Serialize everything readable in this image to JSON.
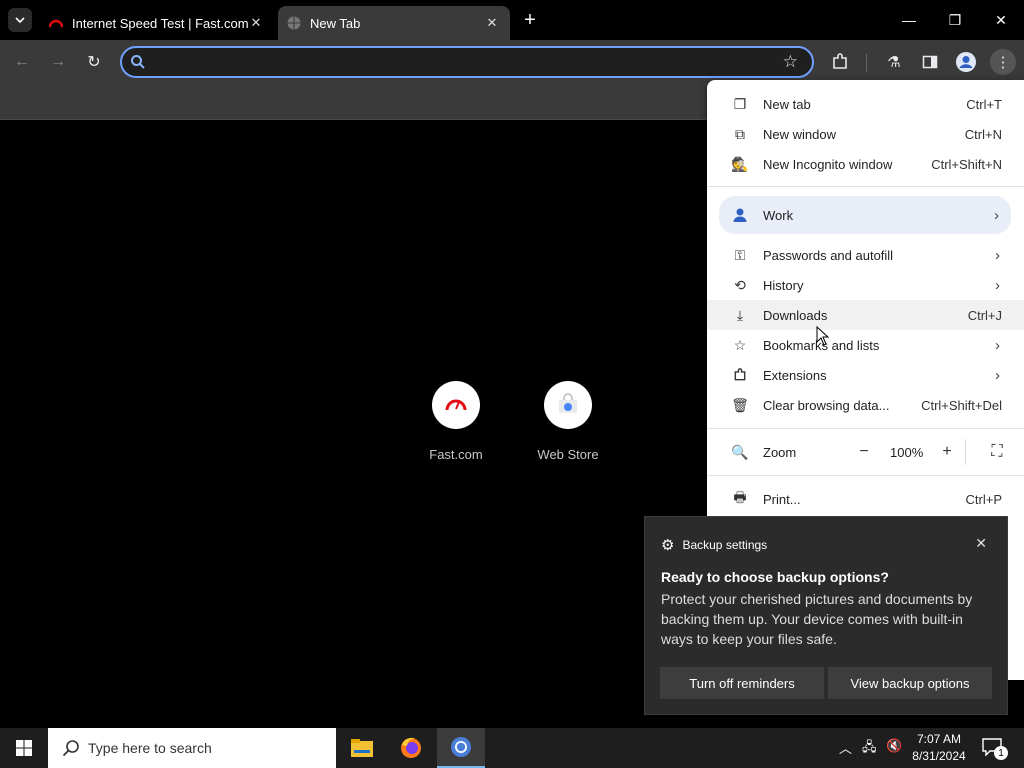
{
  "browser": {
    "tabs": [
      {
        "title": "Internet Speed Test | Fast.com",
        "favicon": "fast-icon"
      },
      {
        "title": "New Tab",
        "favicon": "globe-icon"
      }
    ],
    "new_tab_symbol": "+",
    "omnibox": {
      "value": "",
      "placeholder": ""
    }
  },
  "ntp": {
    "shortcuts": [
      {
        "label": "Fast.com"
      },
      {
        "label": "Web Store"
      }
    ]
  },
  "menu": {
    "items": [
      {
        "label": "New tab",
        "shortcut": "Ctrl+T"
      },
      {
        "label": "New window",
        "shortcut": "Ctrl+N"
      },
      {
        "label": "New Incognito window",
        "shortcut": "Ctrl+Shift+N"
      },
      {
        "label": "Work"
      },
      {
        "label": "Passwords and autofill"
      },
      {
        "label": "History"
      },
      {
        "label": "Downloads",
        "shortcut": "Ctrl+J"
      },
      {
        "label": "Bookmarks and lists"
      },
      {
        "label": "Extensions"
      },
      {
        "label": "Clear browsing data...",
        "shortcut": "Ctrl+Shift+Del"
      },
      {
        "label": "Zoom"
      },
      {
        "label": "Print...",
        "shortcut": "Ctrl+P"
      }
    ],
    "zoom_level": "100%",
    "zoom_minus": "−",
    "zoom_plus": "+"
  },
  "notification": {
    "app": "Backup settings",
    "title": "Ready to choose backup options?",
    "body": "Protect your cherished pictures and documents by backing them up. Your device comes with built-in ways to keep your files safe.",
    "buttons": [
      "Turn off reminders",
      "View backup options"
    ]
  },
  "taskbar": {
    "search_placeholder": "Type here to search",
    "time": "7:07 AM",
    "date": "8/31/2024",
    "notification_count": "1"
  },
  "colors": {
    "accent": "#6fa0ff",
    "fast_red": "#e50914"
  }
}
